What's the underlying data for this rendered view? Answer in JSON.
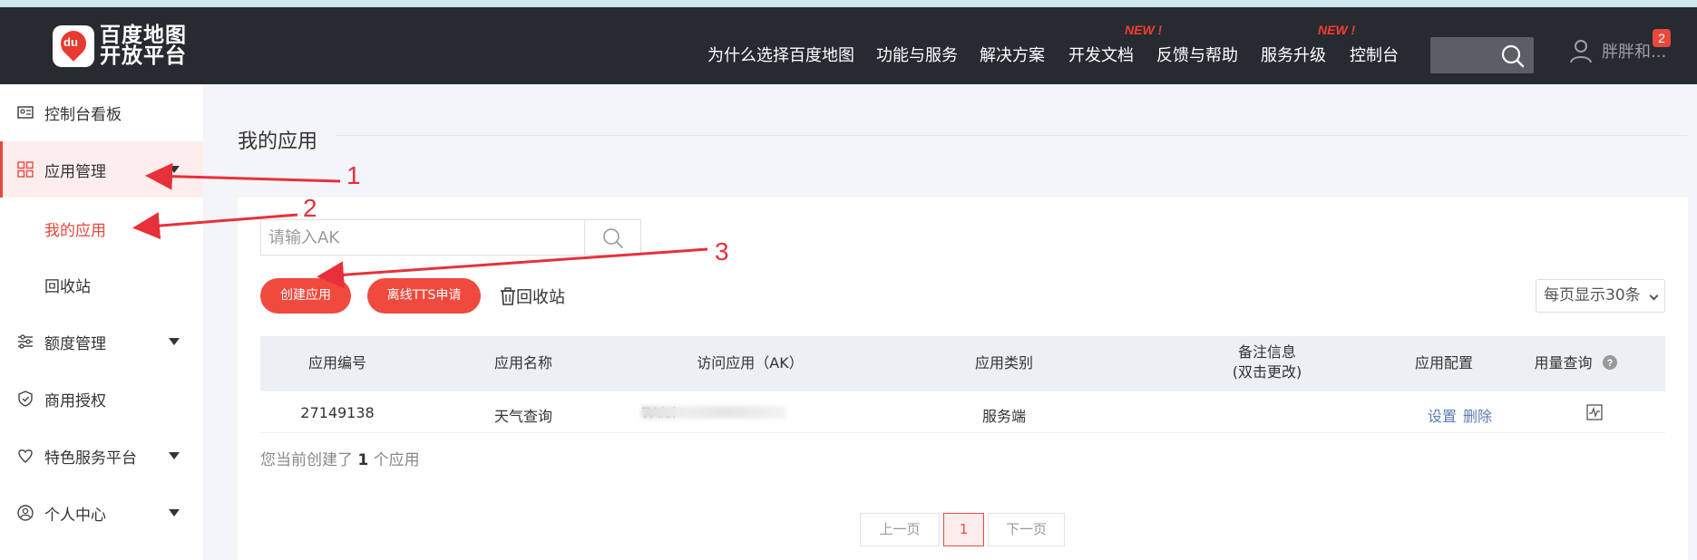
{
  "header": {
    "logo_line1": "百度地图",
    "logo_line2": "开放平台",
    "logo_mark": "du",
    "nav": [
      {
        "label": "为什么选择百度地图"
      },
      {
        "label": "功能与服务"
      },
      {
        "label": "解决方案"
      },
      {
        "label": "开发文档",
        "badge": "NEW !"
      },
      {
        "label": "反馈与帮助"
      },
      {
        "label": "服务升级",
        "badge": "NEW !"
      },
      {
        "label": "控制台"
      }
    ],
    "user_name": "胖胖和...",
    "notification_count": "2"
  },
  "sidebar": {
    "items": [
      {
        "label": "控制台看板",
        "icon": "id-card-icon"
      },
      {
        "label": "应用管理",
        "icon": "grid-icon",
        "active": true
      },
      {
        "label": "额度管理",
        "icon": "sliders-icon"
      },
      {
        "label": "商用授权",
        "icon": "shield-check-icon"
      },
      {
        "label": "特色服务平台",
        "icon": "gem-icon"
      },
      {
        "label": "个人中心",
        "icon": "user-circle-icon"
      }
    ],
    "sub_items": [
      {
        "label": "我的应用",
        "active": true
      },
      {
        "label": "回收站"
      }
    ]
  },
  "main": {
    "title": "我的应用",
    "search_placeholder": "请输入AK",
    "create_button": "创建应用",
    "tts_button": "离线TTS申请",
    "recycle_label": "回收站",
    "per_page": "每页显示30条",
    "table": {
      "headers": [
        "应用编号",
        "应用名称",
        "访问应用（AK）",
        "应用类别",
        "备注信息",
        "(双击更改)",
        "应用配置",
        "用量查询"
      ],
      "rows": [
        {
          "id": "27149138",
          "name": "天气查询",
          "ak": "7Aisi",
          "type": "服务端",
          "note": "",
          "config_set": "设置",
          "config_delete": "删除"
        }
      ]
    },
    "count_prefix": "您当前创建了",
    "count_value": "1",
    "count_suffix": "个应用",
    "pagination": {
      "prev": "上一页",
      "current": "1",
      "next": "下一页"
    }
  },
  "annotations": {
    "n1": "1",
    "n2": "2",
    "n3": "3"
  },
  "colors": {
    "accent": "#f04a3e",
    "header_bg": "#262b31",
    "annotation": "#e8303a"
  }
}
